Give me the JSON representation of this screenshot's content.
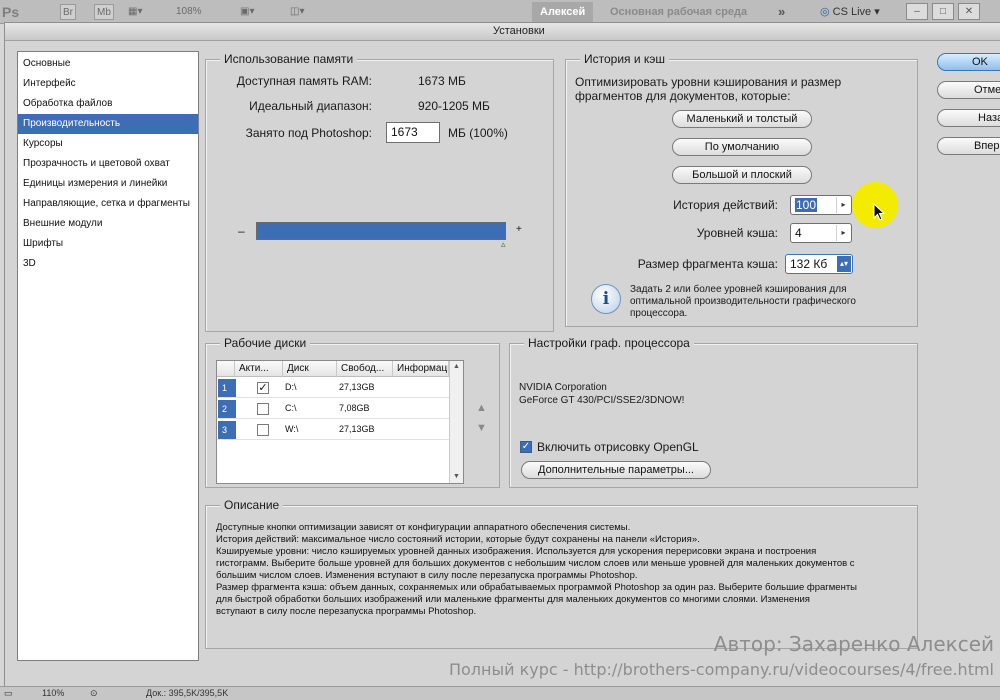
{
  "appbar": {
    "logo": "Ps",
    "btn_br": "Br",
    "btn_mb": "Mb",
    "zoom": "108%",
    "user": "Алексей",
    "workspace": "Основная рабочая среда",
    "more": "»",
    "cslive": "CS Live",
    "win_min": "–",
    "win_max": "□",
    "win_close": "✕"
  },
  "dialog": {
    "title": "Установки"
  },
  "sidebar": {
    "items": [
      {
        "label": "Основные"
      },
      {
        "label": "Интерфейс"
      },
      {
        "label": "Обработка файлов"
      },
      {
        "label": "Производительность",
        "selected": true
      },
      {
        "label": "Курсоры"
      },
      {
        "label": "Прозрачность и цветовой охват"
      },
      {
        "label": "Единицы измерения и линейки"
      },
      {
        "label": "Направляющие, сетка и фрагменты"
      },
      {
        "label": "Внешние модули"
      },
      {
        "label": "Шрифты"
      },
      {
        "label": "3D"
      }
    ]
  },
  "memory": {
    "title": "Использование памяти",
    "available_label": "Доступная память RAM:",
    "available_value": "1673 МБ",
    "ideal_label": "Идеальный диапазон:",
    "ideal_value": "920-1205 МБ",
    "used_label": "Занято под Photoshop:",
    "used_value": "1673",
    "used_suffix": "МБ (100%)",
    "minus": "–",
    "plus": "+",
    "slider_fraction": 1.0
  },
  "history_cache": {
    "title": "История и кэш",
    "intro_line1": "Оптимизировать уровни кэширования и размер",
    "intro_line2": "фрагментов для документов, которые:",
    "btn_tall_thin": "Маленький и толстый",
    "btn_default": "По умолчанию",
    "btn_big_flat": "Большой и плоский",
    "history_states_label": "История действий:",
    "history_states_value": "100",
    "cache_levels_label": "Уровней кэша:",
    "cache_levels_value": "4",
    "tile_size_label": "Размер фрагмента кэша:",
    "tile_size_value": "132 Кб",
    "info_line1": "Задать 2 или более уровней кэширования для",
    "info_line2": "оптимальной производительности графического",
    "info_line3": "процессора."
  },
  "scratch": {
    "title": "Рабочие диски",
    "columns": [
      "Акти...",
      "Диск",
      "Свобод...",
      "Информация"
    ],
    "rows": [
      {
        "num": "1",
        "active": "✓",
        "disk": "D:\\",
        "free": "27,13GB"
      },
      {
        "num": "2",
        "active": "",
        "disk": "C:\\",
        "free": "7,08GB"
      },
      {
        "num": "3",
        "active": "",
        "disk": "W:\\",
        "free": "27,13GB"
      }
    ],
    "move_up": "▲",
    "move_down": "▼"
  },
  "gpu": {
    "title": "Настройки граф. процессора",
    "vendor": "NVIDIA Corporation",
    "model": "GeForce GT 430/PCI/SSE2/3DNOW!",
    "opengl_check": "✓",
    "opengl_label": "Включить отрисовку OpenGL",
    "advanced_button": "Дополнительные параметры..."
  },
  "description": {
    "title": "Описание",
    "lines": [
      "Доступные кнопки оптимизации зависят от конфигурации аппаратного обеспечения системы.",
      "История действий: максимальное число состояний истории, которые будут сохранены на панели «История».",
      "Кэшируемые уровни: число кэшируемых уровней данных изображения. Используется для ускорения перерисовки экрана и построения",
      "гистограмм. Выберите больше уровней для больших документов с небольшим числом слоев или меньше уровней для маленьких документов с",
      "большим числом слоев. Изменения вступают в силу после перезапуска программы Photoshop.",
      "Размер фрагмента кэша: объем данных, сохраняемых или обрабатываемых программой Photoshop за один раз. Выберите большие фрагменты",
      "для быстрой обработки больших изображений или маленькие фрагменты для маленьких документов со многими слоями. Изменения",
      "вступают в силу после перезапуска программы Photoshop."
    ]
  },
  "right_buttons": {
    "ok": "OK",
    "cancel": "Отмена",
    "back": "Назад",
    "next": "Вперед"
  },
  "statusbar": {
    "zoom": "110%",
    "doc": "Док.: 395,5K/395,5K"
  },
  "watermark": {
    "author": "Автор: Захаренко Алексей",
    "course": "Полный курс - http://brothers-company.ru/videocourses/4/free.html"
  }
}
